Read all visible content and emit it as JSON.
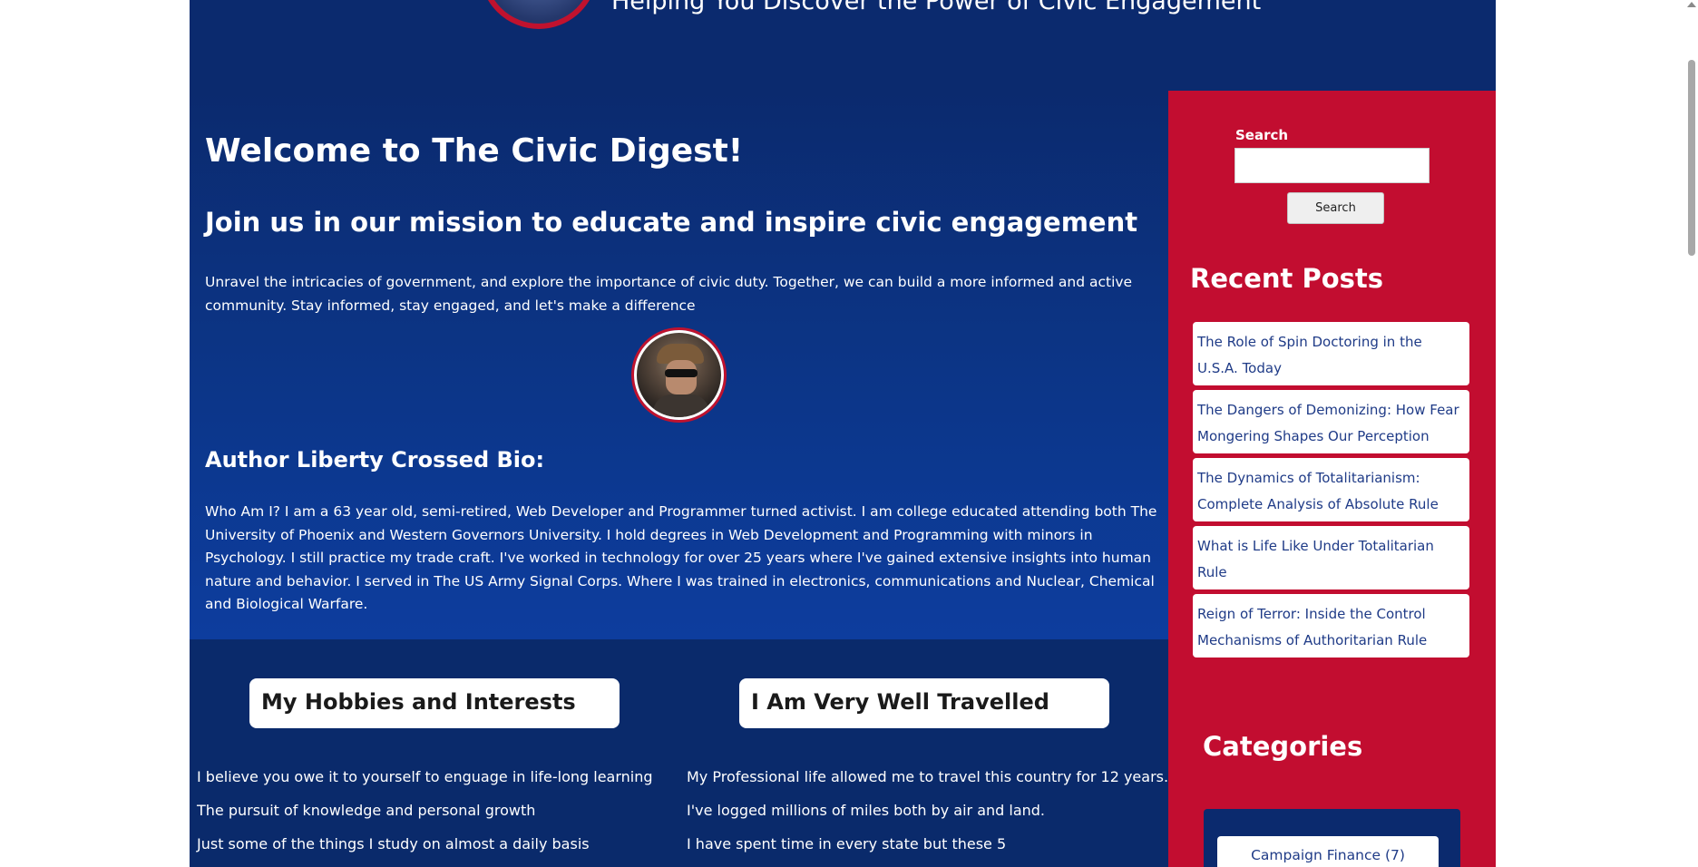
{
  "header": {
    "tagline": "Helping You Discover the Power of Civic Engagement"
  },
  "main": {
    "welcome_title": "Welcome to The Civic Digest!",
    "mission_title": "Join us in our mission to educate and inspire civic engagement",
    "intro_text": "Unravel the intricacies of government, and explore the importance of civic duty. Together, we can build a more informed and active community. Stay informed, stay engaged, and let's make a difference",
    "bio_title": "Author Liberty Crossed Bio:",
    "bio_text": "Who Am I? I am a 63 year old, semi-retired, Web Developer and Programmer turned activist. I am college educated attending both The University of Phoenix and Western Governors University. I hold degrees in Web Development and Programming with minors in Psychology. I still practice my trade craft. I've worked in technology for over 25 years where I've gained extensive insights into human nature and behavior. I served in The US Army Signal Corps. Where I was trained in electronics, communications and Nuclear, Chemical and Biological Warfare."
  },
  "lower": {
    "hobbies": {
      "title": "My Hobbies and Interests",
      "lines": [
        "I believe you owe it to yourself to enguage in life-long learning",
        "The pursuit of knowledge and personal growth",
        "Just some of the things I study on almost a daily basis"
      ]
    },
    "travel": {
      "title": "I Am Very Well Travelled",
      "lines": [
        "My Professional life allowed me to travel this country for 12 years.",
        "I've logged millions of miles both by air and land.",
        "I have spent time in every state but these 5"
      ]
    }
  },
  "sidebar": {
    "search_label": "Search",
    "search_value": "",
    "search_button": "Search",
    "recent_title": "Recent Posts",
    "recent_posts": [
      "The Role of Spin Doctoring in the U.S.A. Today",
      "The Dangers of Demonizing: How Fear Mongering Shapes Our Perception",
      "The Dynamics of Totalitarianism: Complete Analysis of Absolute Rule",
      "What is Life Like Under Totalitarian Rule",
      "Reign of Terror: Inside the Control Mechanisms of Authoritarian Rule"
    ],
    "categories_title": "Categories",
    "categories": [
      {
        "label": "Campaign Finance",
        "count": "(7)"
      }
    ]
  },
  "colors": {
    "navy": "#0b2a6e",
    "red": "#c20d30",
    "link": "#1f3b87"
  }
}
